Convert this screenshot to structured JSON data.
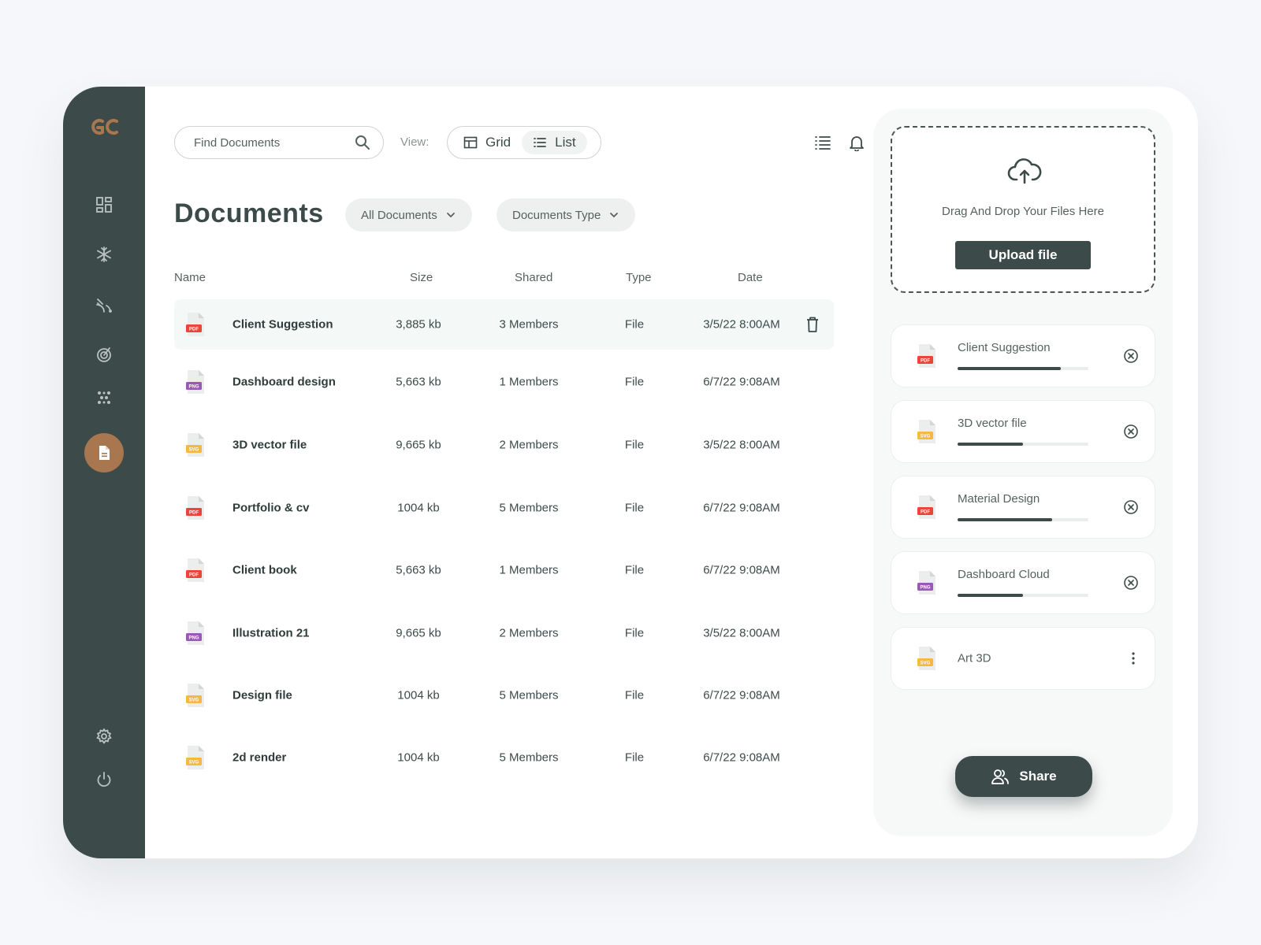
{
  "brand": {
    "logo_text": "GC"
  },
  "sidebar": {
    "items": [
      {
        "icon": "dashboard-icon",
        "active": false
      },
      {
        "icon": "snowflake-icon",
        "active": false
      },
      {
        "icon": "signal-icon",
        "active": false
      },
      {
        "icon": "target-icon",
        "active": false
      },
      {
        "icon": "dots-grid-icon",
        "active": false
      },
      {
        "icon": "document-icon",
        "active": true
      },
      {
        "icon": "gear-icon",
        "active": false
      },
      {
        "icon": "power-icon",
        "active": false
      }
    ]
  },
  "toolbar": {
    "search_placeholder": "Find Documents",
    "view_label": "View:",
    "view_grid": "Grid",
    "view_list": "List",
    "active_view": "List"
  },
  "page": {
    "title": "Documents",
    "filter_all": "All Documents",
    "filter_type": "Documents Type"
  },
  "table": {
    "headers": {
      "name": "Name",
      "size": "Size",
      "shared": "Shared",
      "type": "Type",
      "date": "Date"
    },
    "rows": [
      {
        "name": "Client Suggestion",
        "size": "3,885 kb",
        "shared": "3 Members",
        "type": "File",
        "date": "3/5/22 8:00AM",
        "ext": "PDF",
        "selected": true
      },
      {
        "name": "Dashboard design",
        "size": "5,663 kb",
        "shared": "1 Members",
        "type": "File",
        "date": "6/7/22 9:08AM",
        "ext": "PNG"
      },
      {
        "name": "3D vector file",
        "size": "9,665 kb",
        "shared": "2 Members",
        "type": "File",
        "date": "3/5/22 8:00AM",
        "ext": "SVG"
      },
      {
        "name": "Portfolio & cv",
        "size": "1004 kb",
        "shared": "5 Members",
        "type": "File",
        "date": "6/7/22 9:08AM",
        "ext": "PDF"
      },
      {
        "name": "Client book",
        "size": "5,663 kb",
        "shared": "1 Members",
        "type": "File",
        "date": "6/7/22 9:08AM",
        "ext": "PDF"
      },
      {
        "name": "Illustration 21",
        "size": "9,665 kb",
        "shared": "2 Members",
        "type": "File",
        "date": "3/5/22 8:00AM",
        "ext": "PNG"
      },
      {
        "name": "Design file",
        "size": "1004 kb",
        "shared": "5 Members",
        "type": "File",
        "date": "6/7/22 9:08AM",
        "ext": "SVG"
      },
      {
        "name": "2d render",
        "size": "1004 kb",
        "shared": "5 Members",
        "type": "File",
        "date": "6/7/22 9:08AM",
        "ext": "SVG"
      }
    ]
  },
  "upload": {
    "drop_text": "Drag And Drop Your Files Here",
    "button": "Upload file",
    "items": [
      {
        "name": "Client Suggestion",
        "ext": "PDF",
        "progress": 0.79
      },
      {
        "name": "3D vector file",
        "ext": "SVG",
        "progress": 0.5
      },
      {
        "name": "Material Design",
        "ext": "PDF",
        "progress": 0.72
      },
      {
        "name": "Dashboard Cloud",
        "ext": "PNG",
        "progress": 0.5
      },
      {
        "name": "Art 3D",
        "ext": "SVG",
        "progress": null
      }
    ],
    "share_button": "Share"
  },
  "colors": {
    "primary": "#3c4b49",
    "accent": "#a8764f",
    "pdf": "#e8453c",
    "png": "#9b59b6",
    "svg": "#f5b942"
  }
}
